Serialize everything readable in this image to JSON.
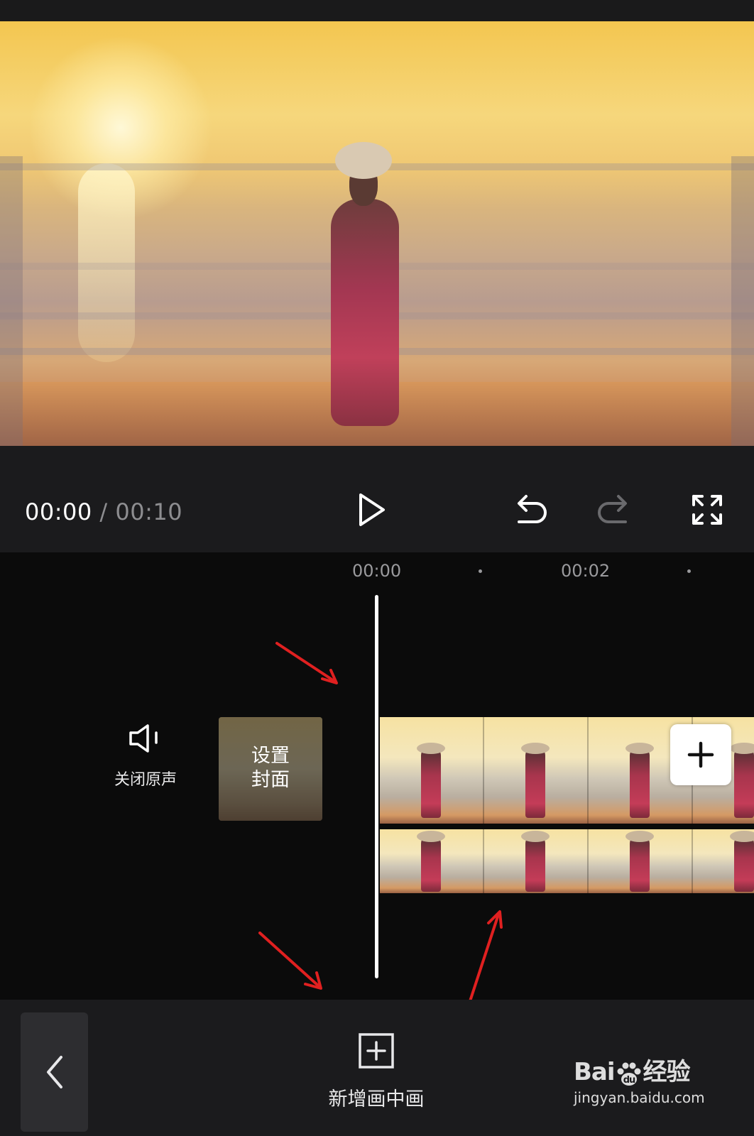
{
  "player": {
    "current_time": "00:00",
    "separator": "/",
    "total_time": "00:10"
  },
  "ruler": {
    "labels": [
      "00:00",
      "00:02"
    ]
  },
  "track": {
    "mute_label": "关闭原声",
    "cover_label": "设置\n封面"
  },
  "bottom": {
    "pip_label": "新增画中画"
  },
  "watermark": {
    "brand_left": "Bai",
    "brand_right": "经验",
    "url": "jingyan.baidu.com"
  },
  "icons": {
    "play": "play-icon",
    "undo": "undo-icon",
    "redo": "redo-icon",
    "fullscreen": "fullscreen-icon",
    "speaker": "speaker-icon",
    "add_clip": "plus-icon",
    "pip_add": "add-box-icon",
    "back": "chevron-left-icon"
  },
  "colors": {
    "background": "#0b0b0b",
    "panel": "#1b1b1d",
    "annotation_arrow": "#e02020",
    "muted_text": "#8d8d90"
  }
}
